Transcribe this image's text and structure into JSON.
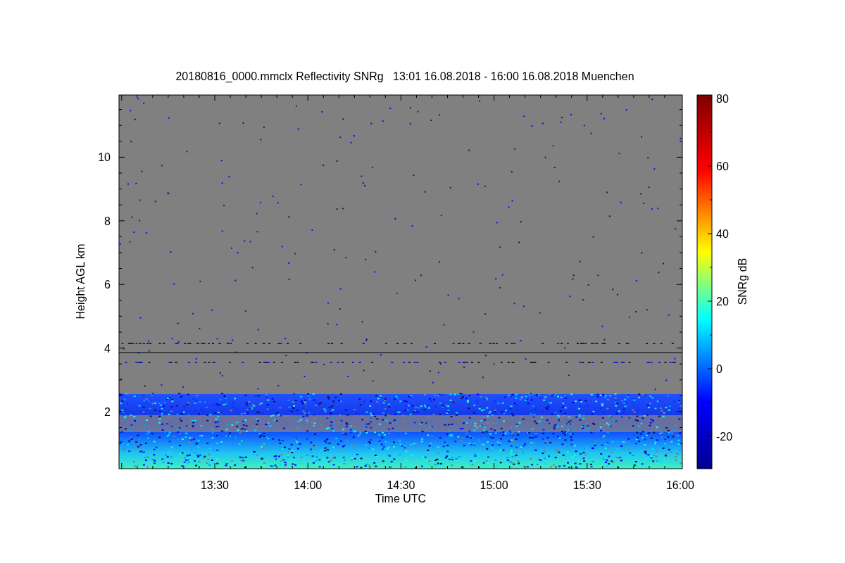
{
  "title": "20180816_0000.mmclx Reflectivity SNRg   13:01 16.08.2018 - 16:00 16.08.2018 Muenchen",
  "x_axis": {
    "label": "Time UTC",
    "ticks": [
      "13:30",
      "14:00",
      "14:30",
      "15:00",
      "15:30",
      "16:00"
    ]
  },
  "y_axis": {
    "label": "Height AGL km",
    "ticks": [
      "10",
      "8",
      "6",
      "4",
      "2"
    ]
  },
  "colorbar": {
    "label": "SNRg dB",
    "ticks": [
      "80",
      "60",
      "40",
      "20",
      "0",
      "-20"
    ]
  }
}
